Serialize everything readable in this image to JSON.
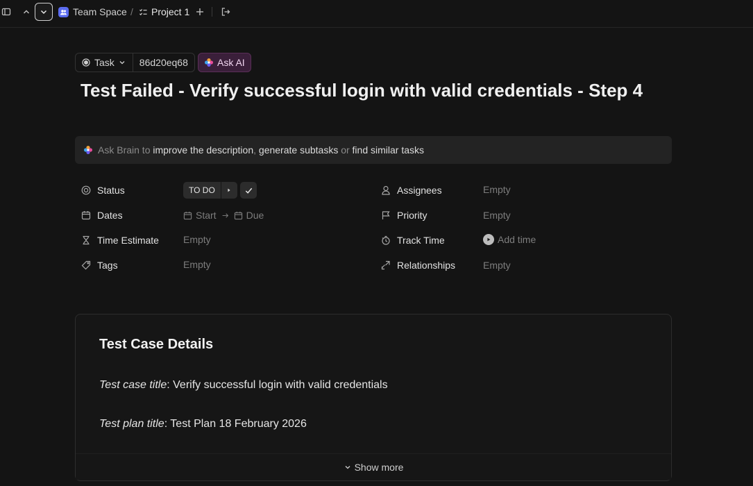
{
  "breadcrumb": {
    "space": "Team Space",
    "separator": "/",
    "list": "Project 1"
  },
  "task": {
    "type_label": "Task",
    "id": "86d20eq68",
    "ask_ai": "Ask AI",
    "title": "Test Failed - Verify successful login with valid credentials - Step 4"
  },
  "brain_bar": {
    "prefix": "Ask Brain to",
    "link1": "improve the description",
    "comma": ",",
    "link2": "generate subtasks",
    "or": "or",
    "link3": "find similar tasks"
  },
  "properties": {
    "status": {
      "label": "Status",
      "value": "TO DO"
    },
    "dates": {
      "label": "Dates",
      "start": "Start",
      "due": "Due"
    },
    "time_estimate": {
      "label": "Time Estimate",
      "value": "Empty"
    },
    "tags": {
      "label": "Tags",
      "value": "Empty"
    },
    "assignees": {
      "label": "Assignees",
      "value": "Empty"
    },
    "priority": {
      "label": "Priority",
      "value": "Empty"
    },
    "track_time": {
      "label": "Track Time",
      "value": "Add time"
    },
    "relationships": {
      "label": "Relationships",
      "value": "Empty"
    }
  },
  "details": {
    "heading": "Test Case Details",
    "case_title_label": "Test case title",
    "case_title_value": ": Verify successful login with valid credentials",
    "plan_title_label": "Test plan title",
    "plan_title_value": ": Test Plan 18 February 2026",
    "show_more": "Show more"
  },
  "colors": {
    "background": "#141414",
    "space_badge": "#5b6cf0",
    "ask_ai_bg": "#3a1f3a"
  }
}
